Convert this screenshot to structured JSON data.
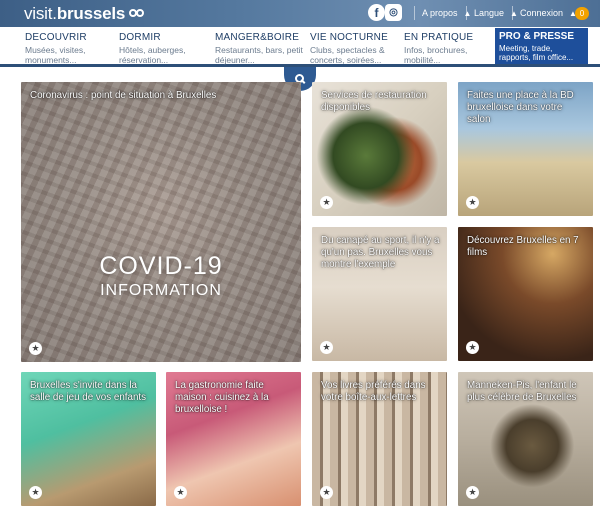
{
  "header": {
    "logo_text_a": "visit.",
    "logo_text_b": "brussels",
    "links": [
      {
        "label": "A propos"
      },
      {
        "label": "Langue"
      },
      {
        "label": "Connexion"
      }
    ],
    "cart_count": "0"
  },
  "nav": {
    "items": [
      {
        "title": "DECOUVRIR",
        "sub": "Musées, visites, monuments..."
      },
      {
        "title": "DORMIR",
        "sub": "Hôtels, auberges, réservation..."
      },
      {
        "title": "MANGER&BOIRE",
        "sub": "Restaurants, bars, petit déjeuner..."
      },
      {
        "title": "VIE NOCTURNE",
        "sub": "Clubs, spectacles & concerts, soirées..."
      },
      {
        "title": "EN PRATIQUE",
        "sub": "Infos, brochures, mobilité..."
      }
    ],
    "pro": {
      "title": "PRO & PRESSE",
      "sub": "Meeting, trade, rapports, film office..."
    }
  },
  "tiles": [
    {
      "caption": "Coronavirus : point de situation à Bruxelles",
      "overlay_title": "COVID-19",
      "overlay_sub": "INFORMATION"
    },
    {
      "caption": "Services de restauration disponibles"
    },
    {
      "caption": "Faites une place à la BD bruxelloise dans votre salon"
    },
    {
      "caption": "Du canapé au sport, il n'y a qu'un pas. Bruxelles vous montre l'exemple"
    },
    {
      "caption": "Découvrez Bruxelles en 7 films"
    },
    {
      "caption": "Bruxelles s'invite dans la salle de jeu de vos enfants"
    },
    {
      "caption": "La gastronomie faite maison : cuisinez à la bruxelloise !"
    },
    {
      "caption": "Vos livres préférés dans votre boîte-aux-lettres"
    },
    {
      "caption": "Manneken-Pis, l'enfant le plus célèbre de Bruxelles"
    }
  ],
  "icons": {
    "facebook": "facebook-icon",
    "instagram": "instagram-icon",
    "search": "search-icon",
    "favorite": "star-icon"
  },
  "colors": {
    "header_blue": "#3d5f86",
    "nav_text": "#1f3e66",
    "pro_blue": "#1e4f9b",
    "cart_orange": "#f2a200"
  }
}
